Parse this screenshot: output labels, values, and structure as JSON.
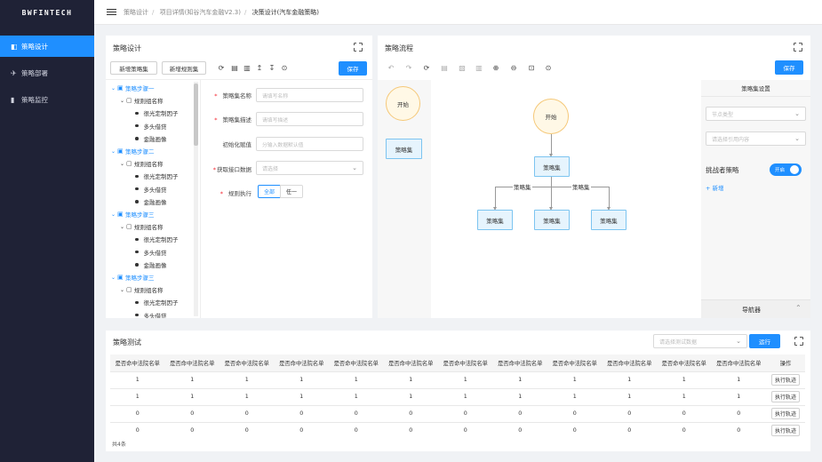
{
  "logo": "BWFINTECH",
  "nav": [
    {
      "label": "策略设计",
      "icon": "◧"
    },
    {
      "label": "策略部署",
      "icon": "✈"
    },
    {
      "label": "策略监控",
      "icon": "▮"
    }
  ],
  "breadcrumb": [
    "策略设计",
    "项目详情(知谷汽车金融V2.3)",
    "决策设计(汽车金融策略)"
  ],
  "design": {
    "title": "策略设计",
    "btn_new_set": "新增策略集",
    "btn_new_rule": "新增规则集",
    "save": "保存",
    "tree": [
      {
        "step": "策略步骤一",
        "group": "规则组名称",
        "items": [
          "很光定制因子",
          "多头借贷",
          "金融画像"
        ]
      },
      {
        "step": "策略步骤二",
        "group": "规则组名称",
        "items": [
          "很光定制因子",
          "多头借贷",
          "金融画像"
        ]
      },
      {
        "step": "策略步骤三",
        "group": "规则组名称",
        "items": [
          "很光定制因子",
          "多头借贷",
          "金融画像"
        ]
      },
      {
        "step": "策略步骤三",
        "group": "规则组名称",
        "items": [
          "很光定制因子",
          "多头借贷"
        ]
      }
    ],
    "form": {
      "name_label": "策略集名称",
      "name_ph": "请填写名称",
      "desc_label": "策略集描述",
      "desc_ph": "请填写描述",
      "init_label": "初始化赋值",
      "init_ph": "分输入数据默认值",
      "data_label": "获取接口数据",
      "data_ph": "请选择",
      "exec_label": "规则执行",
      "exec_all": "全部",
      "exec_any": "任一"
    }
  },
  "flow": {
    "title": "策略流程",
    "save": "保存",
    "palette": {
      "start": "开始",
      "set": "策略集"
    },
    "nodes": {
      "start": "开始",
      "set": "策略集",
      "c1": "策略集",
      "c2": "策略集",
      "c3": "策略集"
    },
    "edge_left": "策略集",
    "edge_right": "策略集",
    "settings": {
      "title": "策略集设置",
      "type_ph": "节点类型",
      "ref_ph": "请选择引用内容",
      "challenger": "挑战者策略",
      "toggle": "开启",
      "add": "+ 新增",
      "navigator": "导航器"
    }
  },
  "test": {
    "title": "策略测试",
    "select_ph": "请选择测试数据",
    "run": "运行",
    "columns": [
      "是否命中法院名单",
      "是否命中法院名单",
      "是否命中法院名单",
      "是否命中法院名单",
      "是否命中法院名单",
      "是否命中法院名单",
      "是否命中法院名单",
      "是否命中法院名单",
      "是否命中法院名单",
      "是否命中法院名单",
      "是否命中法院名单",
      "是否命中法院名单"
    ],
    "op_header": "操作",
    "op_btn": "执行轨迹",
    "rows": [
      [
        "1",
        "1",
        "1",
        "1",
        "1",
        "1",
        "1",
        "1",
        "1",
        "1",
        "1",
        "1"
      ],
      [
        "1",
        "1",
        "1",
        "1",
        "1",
        "1",
        "1",
        "1",
        "1",
        "1",
        "1",
        "1"
      ],
      [
        "0",
        "0",
        "0",
        "0",
        "0",
        "0",
        "0",
        "0",
        "0",
        "0",
        "0",
        "0"
      ],
      [
        "0",
        "0",
        "0",
        "0",
        "0",
        "0",
        "0",
        "0",
        "0",
        "0",
        "0",
        "0"
      ]
    ],
    "total": "共4条"
  },
  "colors": {
    "primary": "#1f8fff",
    "sidebar": "#1f2236"
  }
}
